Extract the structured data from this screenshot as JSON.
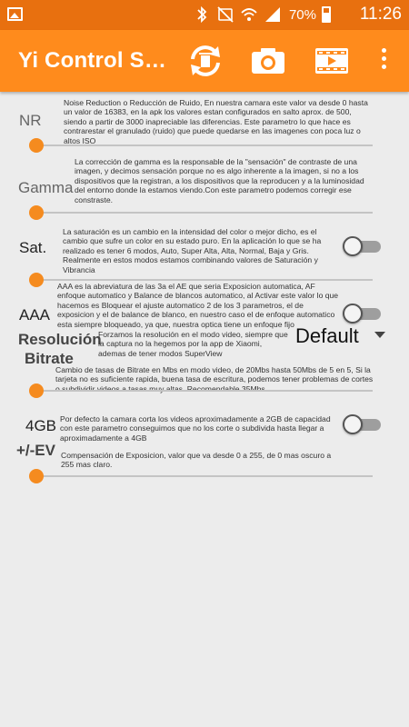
{
  "status_bar": {
    "battery_percent": "70%",
    "time": "11:26",
    "icons": [
      "gallery-icon",
      "bluetooth-icon",
      "mute-icon",
      "wifi-icon",
      "signal-icon",
      "battery-icon"
    ]
  },
  "app_bar": {
    "title": "Yi Control S…",
    "actions": [
      "sync-delete-icon",
      "camera-icon",
      "video-icon",
      "more-vert-icon"
    ]
  },
  "settings": [
    {
      "label": "NR",
      "description": "Noise Reduction o Reducción de Ruido, En nuestra camara este valor va desde 0 hasta un valor de 16383, en la apk los valores estan configurados en salto aprox. de 500, siendo a partir de 3000 inapreciable las diferencias. Este parametro lo que hace es contrarestar el granulado (ruido) que puede quedarse en las imagenes con poca luz o altos ISO",
      "slider_value": 0
    },
    {
      "label": "Gamma",
      "description": "La corrección de gamma es la responsable de la \"sensación\" de contraste de una imagen, y decimos sensación porque no es algo inherente a la imagen, si no a los dispositivos que la registran, a los dispositivos que la reproducen y a la luminosidad del entorno donde la estamos viendo.Con este parametro podemos corregir ese constraste.",
      "slider_value": 0
    },
    {
      "label": "Sat.",
      "description": "La saturación es un cambio en la intensidad del color o mejor dicho, es el cambio que sufre un color en su estado puro. En la aplicación lo que se ha realizado es tener 6 modos, Auto, Super Alta, Alta, Normal, Baja y Gris. Realmente en estos modos estamos combinando valores de Saturación y Vibrancia",
      "toggle": "off",
      "slider_value": 0
    },
    {
      "label": "AAA",
      "description": "AAA es la abreviatura de las 3a el AE que seria Exposicion automatica, AF enfoque automatico y Balance de blancos automatico, al Activar este valor lo que hacemos es Bloquear el ajuste automatico  2 de los 3 parametros, el de exposicion y el de balance de blanco, en nuestro caso el de enfoque automatico esta siempre bloqueado, ya que, nuestra optica tiene un enfoque fijo",
      "toggle": "off"
    },
    {
      "label": "Resolución",
      "description": "Forzamos la resolución en el modo video, siempre que la captura no la hegemos por la app de Xiaomi, ademas de tener modos SuperView",
      "dropdown": "Default"
    },
    {
      "label": "Bitrate",
      "description": "Cambio de tasas de Bitrate en Mbs en modo video, de 20Mbs hasta 50Mbs de 5 en 5, Si la tarjeta no es suficiente rapida, buena tasa de escritura, podemos tener problemas de cortes o subdividir videos a  tasas muy altas. Recomendable 35Mbs",
      "slider_value": 0
    },
    {
      "label": "4GB",
      "description": "Por defecto la camara corta los videos aproximadamente a 2GB de capacidad con este parametro conseguimos que no los corte o subdivida hasta llegar a aproximadamente a 4GB",
      "toggle": "off"
    },
    {
      "label": "+/-EV",
      "description": "Compensación de Exposicion, valor que va desde 0 a 255, de 0 mas oscuro a 255 mas claro.",
      "slider_value": 0
    }
  ],
  "colors": {
    "status_bar": "#e8700f",
    "app_bar": "#ff8b1c",
    "accent": "#f58b1f",
    "background": "#ececec"
  }
}
